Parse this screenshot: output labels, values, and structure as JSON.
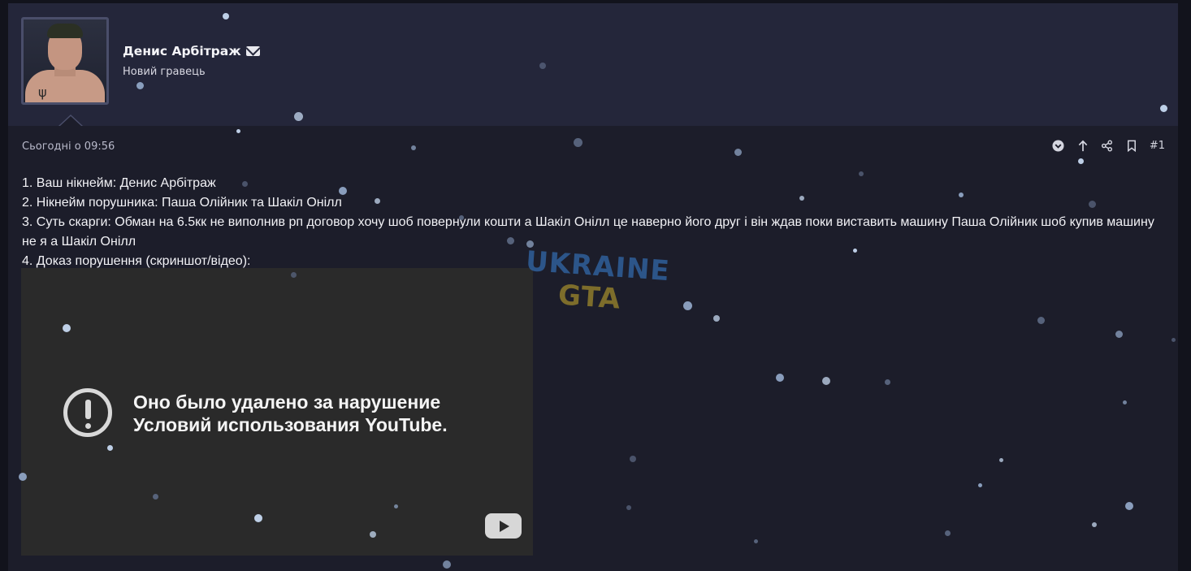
{
  "author": {
    "name": "Денис Арбітраж",
    "title": "Новий гравець"
  },
  "post": {
    "timestamp": "Сьогодні о 09:56",
    "number": "#1",
    "lines": [
      "1. Ваш нікнейм: Денис Арбітраж",
      "2. Нікнейм порушника: Паша Олійник та Шакіл Онілл",
      "3. Суть скарги: Обман на 6.5кк не виполнив рп договор хочу шоб повернули кошти а Шакіл Онілл це наверно його друг і він ждав поки виставить машину Паша Олійник шоб купив машину не я а Шакіл Онілл",
      "4. Доказ порушення (скриншот/відео):"
    ]
  },
  "video": {
    "message_line1": "Оно было удалено за нарушение",
    "message_line2": "Условий использования YouTube."
  },
  "watermark": {
    "line1": "UKRAINE",
    "line2": "GTA"
  },
  "icons": {
    "dropdown": "chevron-circle-icon",
    "up": "arrow-up-icon",
    "share": "share-icon",
    "bookmark": "bookmark-icon",
    "mail": "envelope-icon",
    "warning": "warning-icon",
    "youtube": "youtube-logo"
  },
  "colors": {
    "background": "#1c1d2a",
    "header": "#24263a",
    "video": "#2a2a2a"
  }
}
